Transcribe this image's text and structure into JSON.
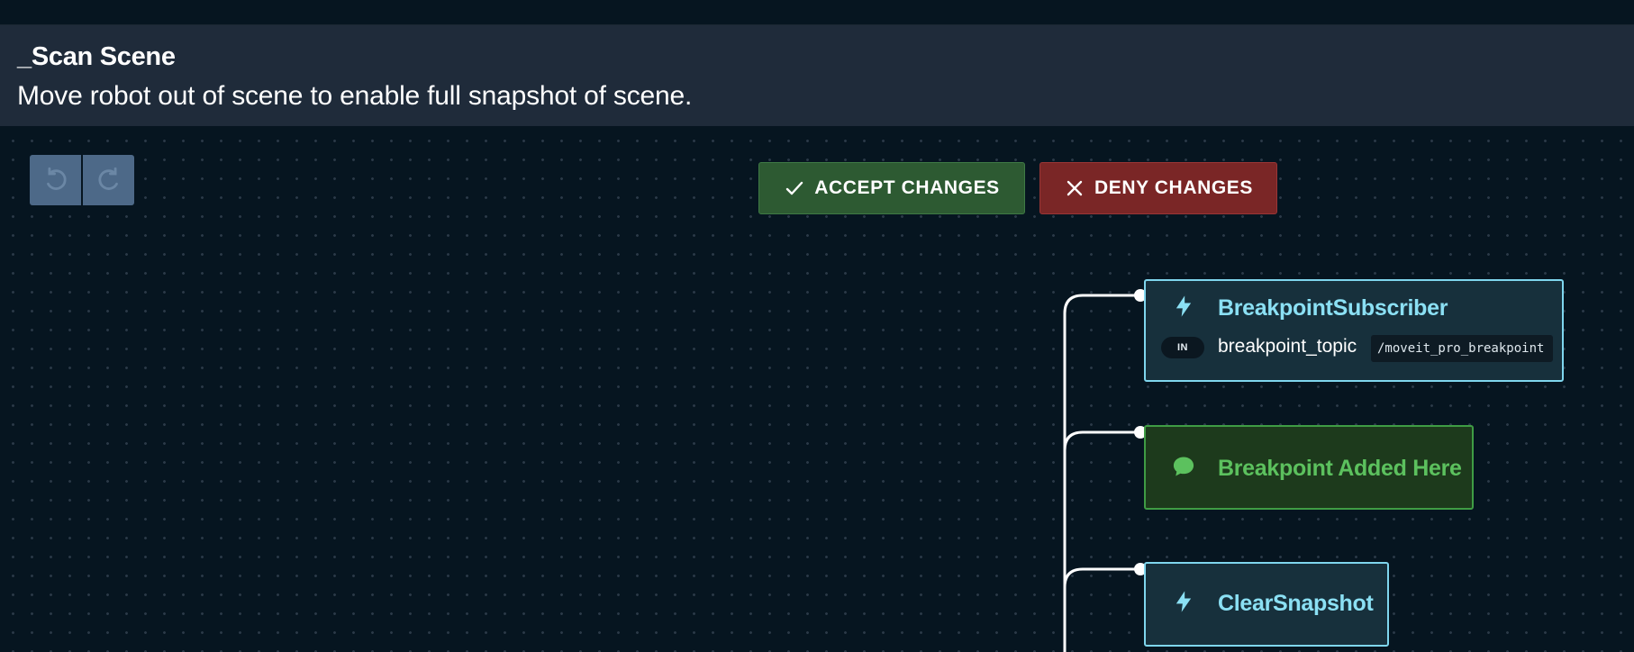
{
  "header": {
    "title": "_Scan Scene",
    "description": "Move robot out of scene to enable full snapshot of scene."
  },
  "toolbar": {
    "undo_icon": "undo-icon",
    "redo_icon": "redo-icon",
    "accept_label": "ACCEPT CHANGES",
    "deny_label": "DENY CHANGES",
    "accept_color": "#2d5a32",
    "deny_color": "#7a2626"
  },
  "nodes": [
    {
      "type": "action",
      "icon": "lightning-icon",
      "label": "BreakpointSubscriber",
      "port": {
        "direction": "IN",
        "name": "breakpoint_topic",
        "value": "/moveit_pro_breakpoint"
      }
    },
    {
      "type": "comment",
      "icon": "speech-bubble-icon",
      "label": "Breakpoint Added Here"
    },
    {
      "type": "action",
      "icon": "lightning-icon",
      "label": "ClearSnapshot"
    }
  ],
  "colors": {
    "action_border": "#7fd6ee",
    "action_text": "#8be0f4",
    "comment_border": "#3f9c44",
    "comment_text": "#5cc15e",
    "canvas_bg": "#061520",
    "header_bg": "#1f2b3a"
  }
}
